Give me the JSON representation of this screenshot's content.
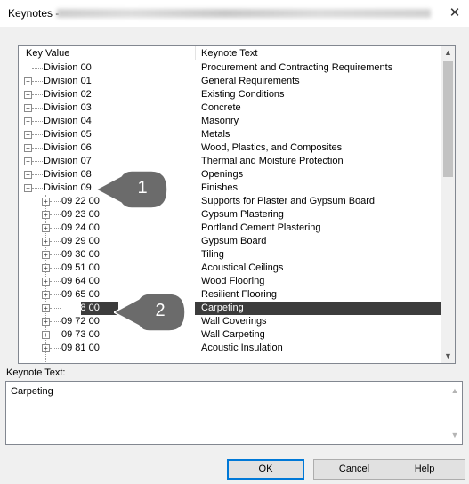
{
  "window": {
    "title": "Keynotes -",
    "close_icon": "close-icon"
  },
  "tree": {
    "header_key": "Key Value",
    "header_text": "Keynote Text",
    "rows": [
      {
        "key": "Division 00",
        "text": "Procurement and Contracting Requirements",
        "level": 0,
        "expander": false
      },
      {
        "key": "Division 01",
        "text": "General Requirements",
        "level": 0,
        "expander": "+"
      },
      {
        "key": "Division 02",
        "text": "Existing Conditions",
        "level": 0,
        "expander": "+"
      },
      {
        "key": "Division 03",
        "text": "Concrete",
        "level": 0,
        "expander": "+"
      },
      {
        "key": "Division 04",
        "text": "Masonry",
        "level": 0,
        "expander": "+"
      },
      {
        "key": "Division 05",
        "text": "Metals",
        "level": 0,
        "expander": "+"
      },
      {
        "key": "Division 06",
        "text": "Wood, Plastics, and Composites",
        "level": 0,
        "expander": "+"
      },
      {
        "key": "Division 07",
        "text": "Thermal and Moisture Protection",
        "level": 0,
        "expander": "+"
      },
      {
        "key": "Division 08",
        "text": "Openings",
        "level": 0,
        "expander": "+"
      },
      {
        "key": "Division 09",
        "text": "Finishes",
        "level": 0,
        "expander": "-"
      },
      {
        "key": "09 22 00",
        "text": "Supports for Plaster and Gypsum Board",
        "level": 1,
        "expander": "+"
      },
      {
        "key": "09 23 00",
        "text": "Gypsum Plastering",
        "level": 1,
        "expander": "+"
      },
      {
        "key": "09 24 00",
        "text": "Portland Cement Plastering",
        "level": 1,
        "expander": "+"
      },
      {
        "key": "09 29 00",
        "text": "Gypsum Board",
        "level": 1,
        "expander": "+"
      },
      {
        "key": "09 30 00",
        "text": "Tiling",
        "level": 1,
        "expander": "+"
      },
      {
        "key": "09 51 00",
        "text": "Acoustical Ceilings",
        "level": 1,
        "expander": "+"
      },
      {
        "key": "09 64 00",
        "text": "Wood Flooring",
        "level": 1,
        "expander": "+"
      },
      {
        "key": "09 65 00",
        "text": "Resilient Flooring",
        "level": 1,
        "expander": "+"
      },
      {
        "key": "09 68 00",
        "text": "Carpeting",
        "level": 1,
        "expander": "+",
        "selected": true
      },
      {
        "key": "09 72 00",
        "text": "Wall Coverings",
        "level": 1,
        "expander": "+"
      },
      {
        "key": "09 73 00",
        "text": "Wall Carpeting",
        "level": 1,
        "expander": "+"
      },
      {
        "key": "09 81 00",
        "text": "Acoustic Insulation",
        "level": 1,
        "expander": "+"
      }
    ]
  },
  "keynote_text": {
    "label": "Keynote Text:",
    "value": "Carpeting"
  },
  "buttons": {
    "ok": "OK",
    "cancel": "Cancel",
    "help": "Help"
  },
  "callouts": {
    "one": "1",
    "two": "2"
  },
  "colors": {
    "selection": "#3c3c3c",
    "callout": "#6b6b6b"
  }
}
